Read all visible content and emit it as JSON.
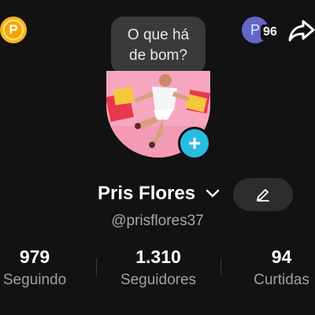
{
  "header": {
    "coin_letter": "P",
    "badge_letter": "P",
    "badge_count": "96"
  },
  "bubble": {
    "text_line1": "O que há",
    "text_line2": "de bom?"
  },
  "profile": {
    "name": "Pris Flores",
    "handle": "@prisflores37"
  },
  "stats": [
    {
      "value": "979",
      "label": "Seguindo"
    },
    {
      "value": "1.310",
      "label": "Seguidores"
    },
    {
      "value": "94",
      "label": "Curtidas"
    }
  ],
  "colors": {
    "background": "#121212",
    "coin": "#f6b820",
    "badge": "#6366c8",
    "add_button": "#27bde0",
    "avatar_bg": "#f7a6bf"
  },
  "icons": [
    "coin-icon",
    "share-icon",
    "chevron-down-icon",
    "pencil-icon",
    "plus-icon"
  ]
}
